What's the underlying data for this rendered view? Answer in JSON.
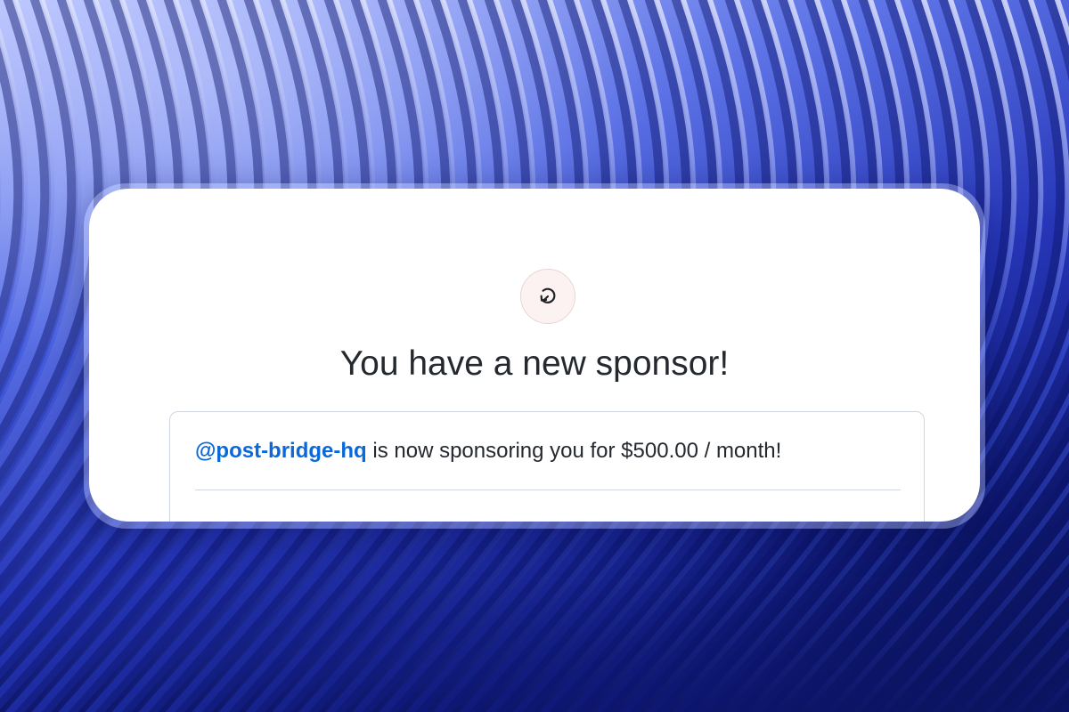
{
  "notification": {
    "icon": "sponsor-refresh-icon",
    "title": "You have a new sponsor!",
    "sponsor_handle": "@post-bridge-hq",
    "message_text": " is now sponsoring you for $500.00 / month!"
  },
  "colors": {
    "link": "#0969da",
    "text": "#24292f",
    "border": "#d0d7de",
    "icon_bg": "#fdf2f2",
    "background_accent": "#2636b8"
  }
}
